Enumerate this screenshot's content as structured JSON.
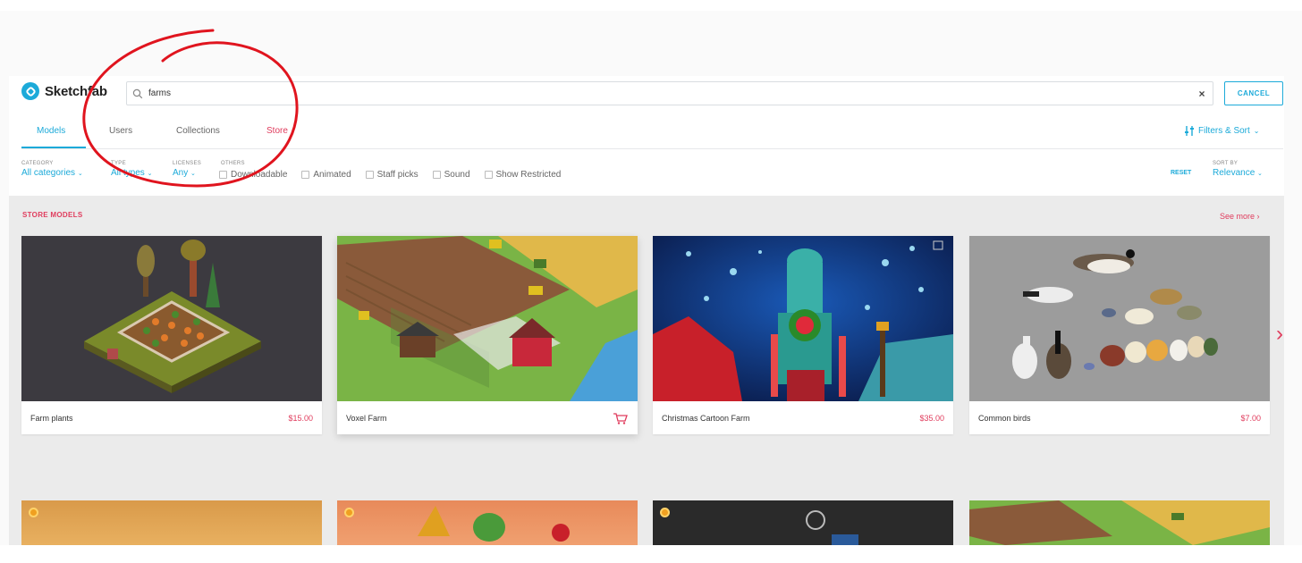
{
  "app": {
    "logo_text": "Sketchfab"
  },
  "search": {
    "value": "farms",
    "clear": "×",
    "cancel_label": "CANCEL"
  },
  "tabs": [
    {
      "label": "Models"
    },
    {
      "label": "Users"
    },
    {
      "label": "Collections"
    },
    {
      "label": "Store"
    }
  ],
  "filters_sort_label": "Filters & Sort",
  "filters": {
    "category": {
      "label": "CATEGORY",
      "value": "All categories"
    },
    "type": {
      "label": "TYPE",
      "value": "All types"
    },
    "licenses": {
      "label": "LICENSES",
      "value": "Any"
    },
    "others_label": "OTHERS",
    "checks": [
      {
        "label": "Downloadable"
      },
      {
        "label": "Animated"
      },
      {
        "label": "Staff picks"
      },
      {
        "label": "Sound"
      },
      {
        "label": "Show Restricted"
      }
    ],
    "reset_label": "RESET",
    "sort": {
      "label": "SORT BY",
      "value": "Relevance"
    }
  },
  "section": {
    "title": "STORE MODELS",
    "see_more": "See more",
    "next_arrow": "›"
  },
  "cards": [
    {
      "name": "Farm plants",
      "price": "$15.00"
    },
    {
      "name": "Voxel Farm",
      "price": ""
    },
    {
      "name": "Christmas Cartoon Farm",
      "price": "$35.00"
    },
    {
      "name": "Common birds",
      "price": "$7.00"
    }
  ],
  "colors": {
    "brand": "#1caad9",
    "store_accent": "#e03c5d",
    "annotation": "#e0141e"
  }
}
